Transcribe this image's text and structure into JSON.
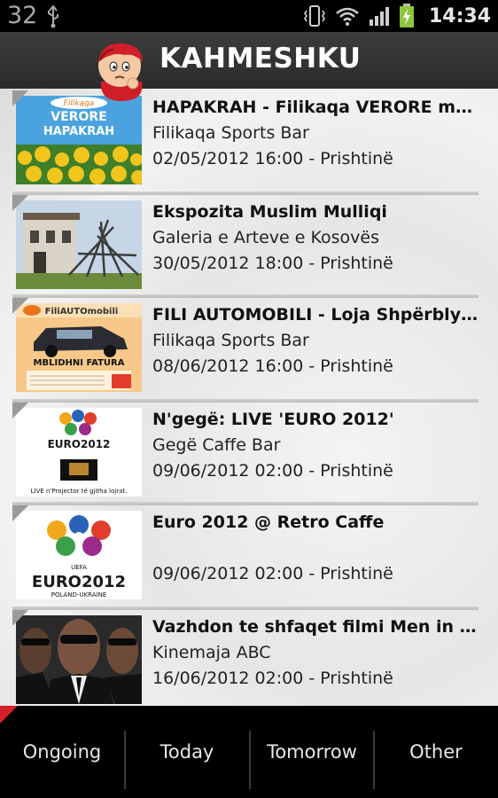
{
  "status_bar": {
    "notification_count": "32",
    "time": "14:34",
    "icons": [
      "usb-icon",
      "vibrate-icon",
      "wifi-icon",
      "signal-icon",
      "battery-charging-icon"
    ]
  },
  "header": {
    "title": "KAHMESHKU",
    "logo": "mascot-logo"
  },
  "events": [
    {
      "title": "HAPAKRAH - Filikaqa VERORE me t...",
      "venue": "Filikaqa Sports Bar",
      "datetime": "02/05/2012 16:00 - Prishtinë",
      "thumb_text": "Filikaqa VERORE HAPAKRAH"
    },
    {
      "title": "Ekspozita Muslim Mulliqi",
      "venue": "Galeria e Arteve e Kosovës",
      "datetime": "30/05/2012 18:00 - Prishtinë"
    },
    {
      "title": "FILI AUTOMOBILI - Loja Shpërblyese",
      "venue": "Filikaqa Sports Bar",
      "datetime": "08/06/2012 16:00 - Prishtinë",
      "thumb_text": "FiliAUTOmobili MBLIDHNI FATURA"
    },
    {
      "title": "N'gegë: LIVE 'EURO 2012'",
      "venue": "Gegë Caffe Bar",
      "datetime": "09/06/2012 02:00 - Prishtinë",
      "thumb_text": "EURO2012 LIVE n'Projector të gjitha lojrat."
    },
    {
      "title": "Euro 2012 @ Retro Caffe",
      "venue": "",
      "datetime": "09/06/2012 02:00 - Prishtinë",
      "thumb_text": "EURO2012 POLAND-UKRAINE"
    },
    {
      "title": "Vazhdon te shfaqet filmi Men in Bl...",
      "venue": "Kinemaja ABC",
      "datetime": "16/06/2012 02:00 - Prishtinë"
    }
  ],
  "tabs": [
    {
      "label": "Ongoing"
    },
    {
      "label": "Today"
    },
    {
      "label": "Tomorrow"
    },
    {
      "label": "Other"
    }
  ],
  "colors": {
    "accent_red": "#d3202a",
    "title_bar": "#333333",
    "tab_bar": "#000000"
  }
}
